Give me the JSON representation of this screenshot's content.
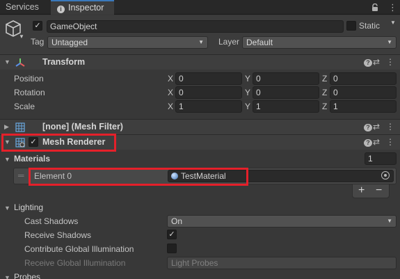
{
  "tabs": [
    {
      "label": "Services"
    },
    {
      "label": "Inspector"
    }
  ],
  "tabbar_icons": {
    "lock": "lock-icon",
    "menu": "menu-icon"
  },
  "gameobject": {
    "active": true,
    "name": "GameObject",
    "static_label": "Static",
    "static_checked": false,
    "tag_label": "Tag",
    "tag_value": "Untagged",
    "layer_label": "Layer",
    "layer_value": "Default"
  },
  "transform": {
    "title": "Transform",
    "rows": [
      {
        "label": "Position",
        "x": "0",
        "y": "0",
        "z": "0"
      },
      {
        "label": "Rotation",
        "x": "0",
        "y": "0",
        "z": "0"
      },
      {
        "label": "Scale",
        "x": "1",
        "y": "1",
        "z": "1"
      }
    ],
    "axes": {
      "x": "X",
      "y": "Y",
      "z": "Z"
    }
  },
  "mesh_filter": {
    "title": "[none] (Mesh Filter)"
  },
  "mesh_renderer": {
    "title": "Mesh Renderer",
    "enabled": true,
    "materials_label": "Materials",
    "materials_count": "1",
    "element_label": "Element 0",
    "element_value": "TestMaterial",
    "add_label": "+",
    "remove_label": "−",
    "lighting_label": "Lighting",
    "cast_shadows_label": "Cast Shadows",
    "cast_shadows_value": "On",
    "receive_shadows_label": "Receive Shadows",
    "receive_shadows_checked": true,
    "contribute_gi_label": "Contribute Global Illumination",
    "contribute_gi_checked": false,
    "receive_gi_label": "Receive Global Illumination",
    "receive_gi_value": "Light Probes",
    "probes_label": "Probes"
  },
  "colors": {
    "background": "#383838",
    "header": "#3e3e3e",
    "field": "#2a2a2a",
    "highlight": "#e5202a",
    "accent": "#3a79bb"
  }
}
